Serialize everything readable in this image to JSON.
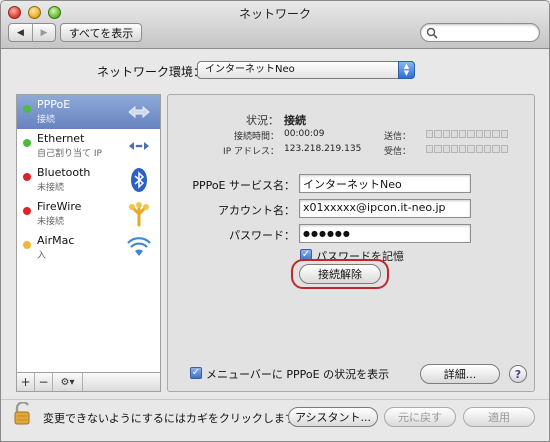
{
  "window": {
    "title": "ネットワーク"
  },
  "toolbar": {
    "show_all_label": "すべてを表示",
    "search": {
      "value": "",
      "placeholder": ""
    }
  },
  "location": {
    "label": "ネットワーク環境：",
    "value": "インターネットNeo"
  },
  "services": [
    {
      "name": "PPPoE",
      "status": "接続",
      "dot_color": "#4cbb3f",
      "icon": "arrows-icon",
      "selected": true
    },
    {
      "name": "Ethernet",
      "status": "自己割り当て IP",
      "dot_color": "#4cbb3f",
      "icon": "ethernet-icon",
      "selected": false
    },
    {
      "name": "Bluetooth",
      "status": "未接続",
      "dot_color": "#d9252a",
      "icon": "bluetooth-icon",
      "selected": false
    },
    {
      "name": "FireWire",
      "status": "未接続",
      "dot_color": "#d9252a",
      "icon": "firewire-icon",
      "selected": false
    },
    {
      "name": "AirMac",
      "status": "入",
      "dot_color": "#f0b732",
      "icon": "wifi-icon",
      "selected": false
    }
  ],
  "sidebar_tools": {
    "add": "+",
    "remove": "−",
    "gear": "⚙▾"
  },
  "status": {
    "status_label": "状況：",
    "status_value": "接続",
    "time_label": "接続時間：",
    "time_value": "00:00:09",
    "ip_label": "IP アドレス：",
    "ip_value": "123.218.219.135",
    "send_label": "送信：",
    "receive_label": "受信："
  },
  "form": {
    "service_name_label": "PPPoE サービス名：",
    "service_name_value": "インターネットNeo",
    "account_label": "アカウント名：",
    "account_value": "x01xxxxx@ipcon.it-neo.jp",
    "password_label": "パスワード：",
    "password_value": "●●●●●●",
    "remember_password_label": "パスワードを記憶",
    "remember_password_checked": true,
    "disconnect_label": "接続解除"
  },
  "panel_footer": {
    "show_menubar_label": "メニューバーに PPPoE の状況を表示",
    "show_menubar_checked": true,
    "details_label": "詳細...",
    "help_label": "?"
  },
  "footer": {
    "lock_text": "変更できないようにするにはカギをクリックします。",
    "assistant_label": "アシスタント...",
    "revert_label": "元に戻す",
    "apply_label": "適用"
  },
  "colors": {
    "accent": "#3f72c9",
    "highlight_ring": "#c0272d",
    "selection": "#7a96cc"
  }
}
